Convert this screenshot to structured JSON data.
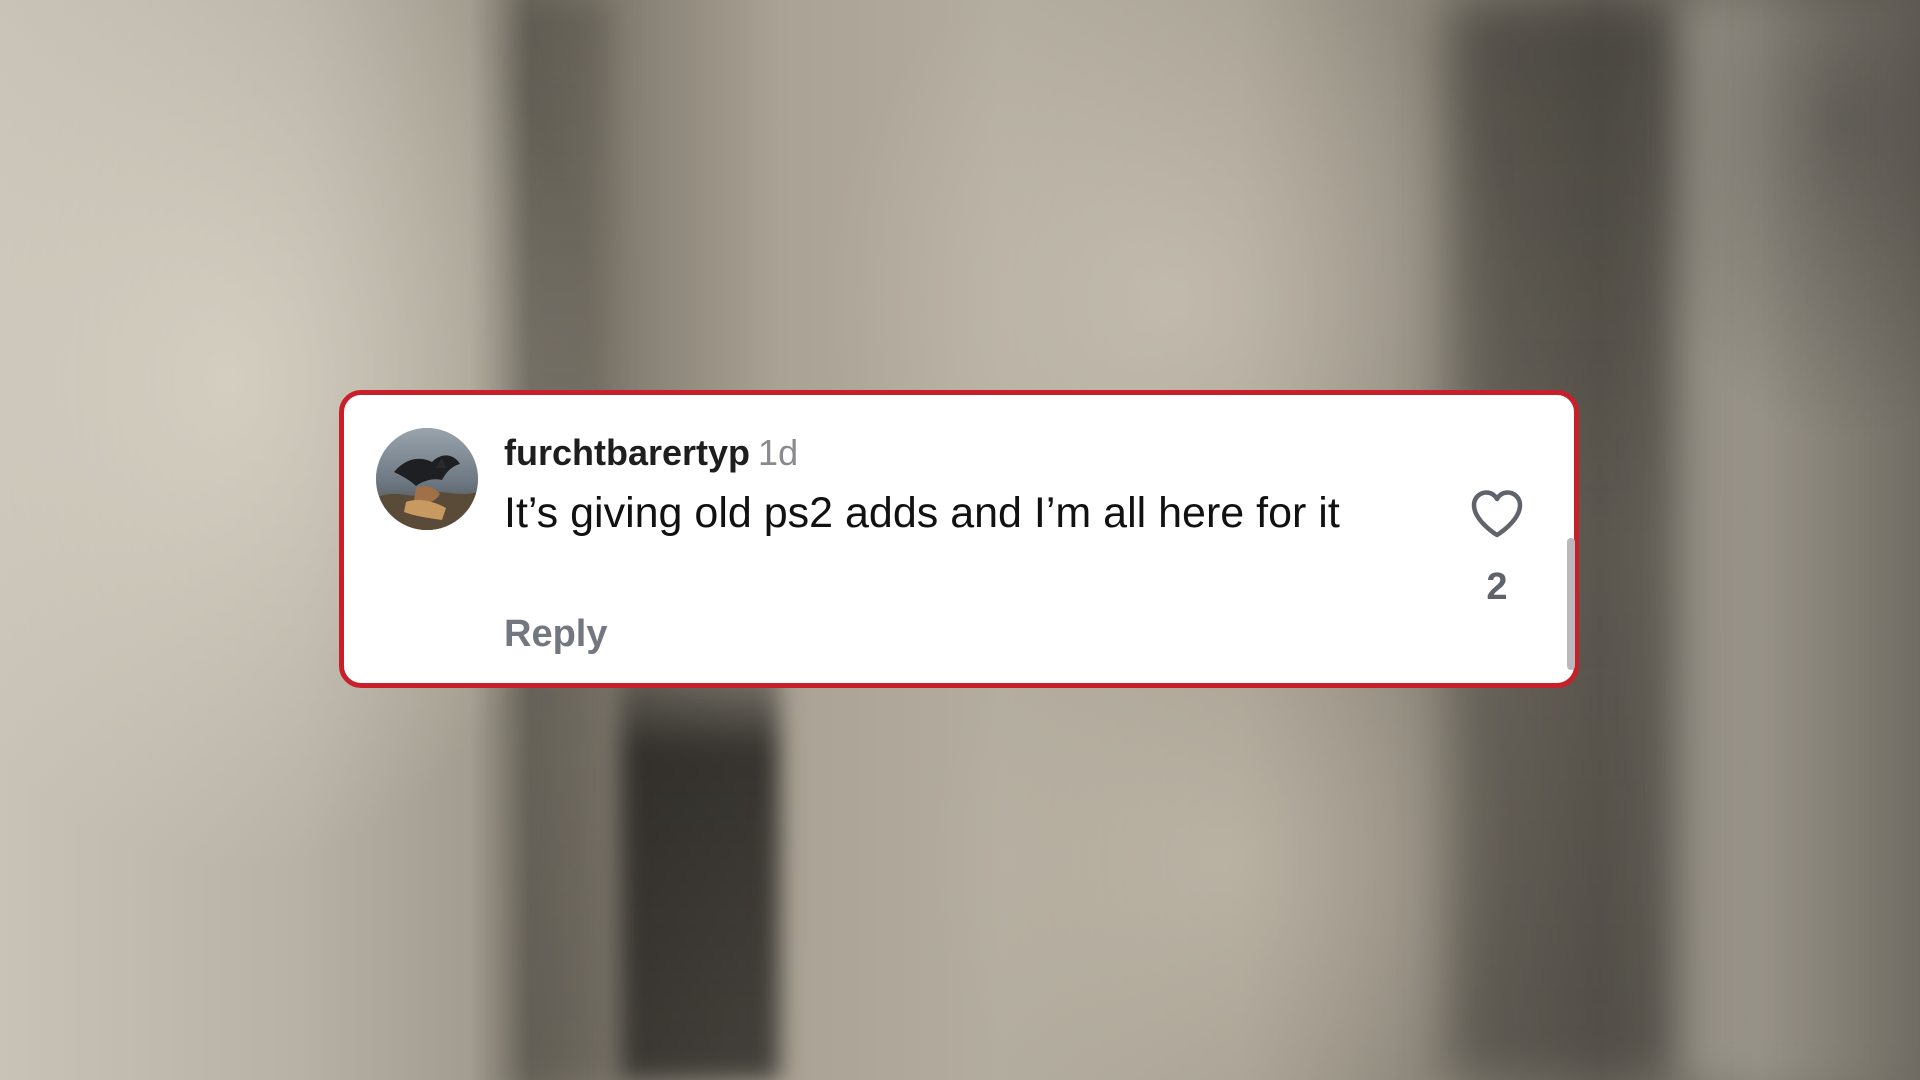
{
  "comment": {
    "username": "furchtbarertyp",
    "timestamp": "1d",
    "text": "It’s giving old ps2 adds and I’m all here for it",
    "reply_label": "Reply",
    "like_count": "2",
    "like_icon": "heart-outline-icon",
    "avatar_icon": "profile-avatar"
  },
  "colors": {
    "card_border": "#c8202b",
    "card_background": "#ffffff",
    "username": "#1e1e1e",
    "timestamp": "#8a8a8f",
    "reply": "#737780",
    "like_count": "#5f636b"
  }
}
